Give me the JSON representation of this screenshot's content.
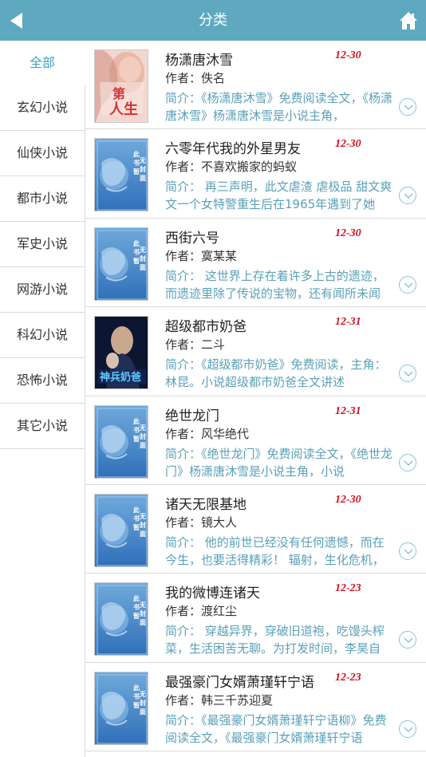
{
  "header": {
    "title": "分类",
    "bg_color": "#5fa9c0"
  },
  "sidebar": {
    "items": [
      {
        "label": "全部",
        "active": true
      },
      {
        "label": "玄幻小说"
      },
      {
        "label": "仙侠小说"
      },
      {
        "label": "都市小说"
      },
      {
        "label": "军史小说"
      },
      {
        "label": "网游小说"
      },
      {
        "label": "科幻小说"
      },
      {
        "label": "恐怖小说"
      },
      {
        "label": "其它小说"
      }
    ],
    "active_color": "#3ba2c8"
  },
  "books": [
    {
      "title": "杨潇唐沐雪",
      "date": "12-30",
      "author": "作者：佚名",
      "intro": "简介：《杨潇唐沐雪》免费阅读全文，《杨潇唐沐雪》杨潇唐沐雪是小说主角，",
      "cover": "photo-cover",
      "cover_text": "第一人生"
    },
    {
      "title": "六零年代我的外星男友",
      "date": "12-30",
      "author": "作者：不喜欢搬家的蚂蚁",
      "intro": "简介： 再三声明，此文虐渣 虐极品 甜文爽文一个女特警重生后在1965年遇到了她",
      "cover": "no-cover",
      "cover_text": "此书暂无封面"
    },
    {
      "title": "西街六号",
      "date": "12-30",
      "author": "作者：寞某某",
      "intro": "简介： 这世界上存在着许多上古的遗迹，而遗迹里除了传说的宝物，还有闻所未闻",
      "cover": "no-cover",
      "cover_text": "此书暂无封面"
    },
    {
      "title": "超级都市奶爸",
      "date": "12-31",
      "author": "作者：二斗",
      "intro": "简介：《超级都市奶爸》免费阅读，主角：林昆。小说超级都市奶爸全文讲述",
      "cover": "photo-cover-dark",
      "cover_text": "神兵奶爸"
    },
    {
      "title": "绝世龙门",
      "date": "12-31",
      "author": "作者：风华绝代",
      "intro": "简介：《绝世龙门》免费阅读全文，《绝世龙门》杨潇唐沐雪是小说主角，小说",
      "cover": "no-cover",
      "cover_text": "此书暂无封面"
    },
    {
      "title": "诸天无限基地",
      "date": "12-30",
      "author": "作者：镜大人",
      "intro": "简介： 他的前世已经没有任何遗憾，而在今生，也要活得精彩！ 辐射，生化危机，",
      "cover": "no-cover",
      "cover_text": "此书暂无封面"
    },
    {
      "title": "我的微博连诸天",
      "date": "12-23",
      "author": "作者：渡红尘",
      "intro": "简介： 穿越异界，穿破旧道袍，吃馒头榨菜，生活困苦无聊。为打发时间，李昊自",
      "cover": "no-cover",
      "cover_text": "此书暂无封面"
    },
    {
      "title": "最强豪门女婿萧瑾轩宁语",
      "date": "12-23",
      "author": "作者：韩三千苏迎夏",
      "intro": "简介：《最强豪门女婿萧瑾轩宁语柳》免费阅读全文，《最强豪门女婿萧瑾轩宁语",
      "cover": "no-cover",
      "cover_text": "此书暂无封面"
    }
  ]
}
